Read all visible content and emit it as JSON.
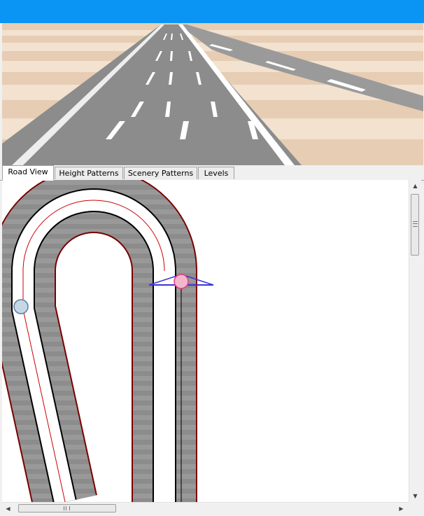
{
  "window": {
    "accent_color": "#0a95f5"
  },
  "preview": {
    "sky_color": "#0a95f5",
    "ground_colors": [
      "#f2e2cf",
      "#e6cdb3"
    ],
    "road_color": "#8c8c8c",
    "line_color": "#ffffff"
  },
  "tabs": [
    {
      "label": "Road View",
      "active": true
    },
    {
      "label": "Height Patterns",
      "active": false
    },
    {
      "label": "Scenery Patterns",
      "active": false
    },
    {
      "label": "Levels",
      "active": false
    }
  ],
  "editor": {
    "road_color": "#8c8c8c",
    "outline_color": "#7a0000",
    "centerline_color": "#cc0000",
    "start_marker": {
      "fill": "#c6d7e6",
      "stroke": "#5b7fa0"
    },
    "selected_marker": {
      "fill": "#f4b6cc",
      "stroke": "#e04080"
    },
    "handle_color": "#3b35d6"
  },
  "scrollbars": {
    "vertical": {
      "up_arrow": "▲",
      "down_arrow": "▼"
    },
    "horizontal": {
      "left_arrow": "◀",
      "right_arrow": "▶"
    }
  }
}
